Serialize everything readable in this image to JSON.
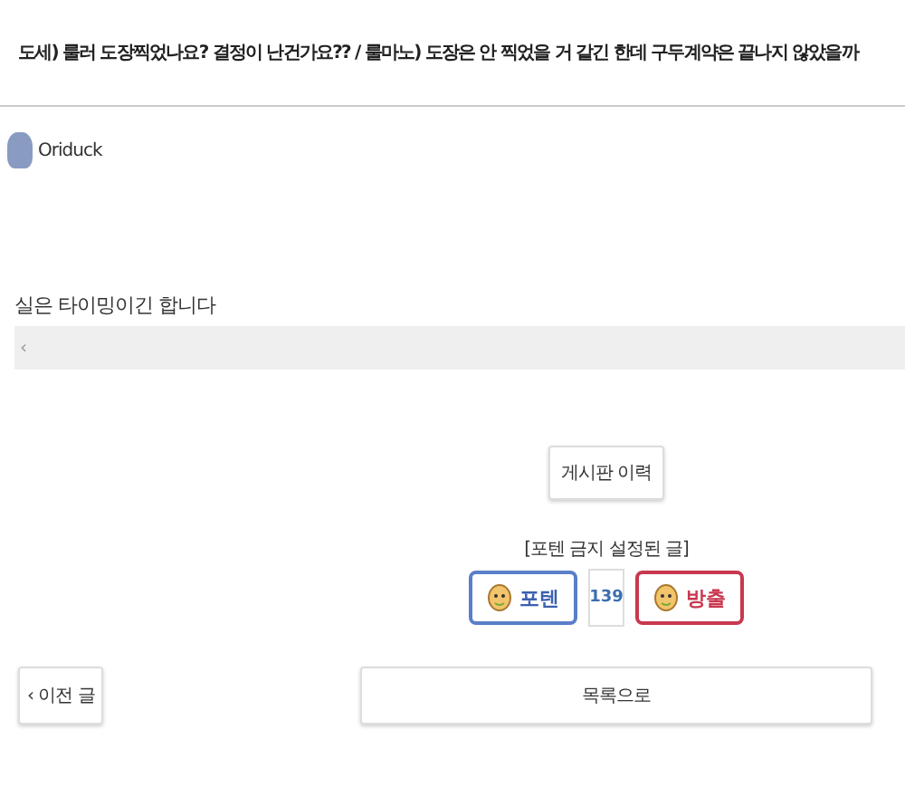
{
  "post": {
    "title": "도세) 룰러 도장찍었나요? 결정이 난건가요?? / 룰마노) 도장은 안 찍었을 거 같긴 한데 구두계약은 끝나지 않았을까",
    "author": "Oriduck",
    "body": "실은 타이밍이긴 합니다",
    "quote": "‹"
  },
  "history_button": "게시판 이력",
  "vote": {
    "notice": "[포텐 금지 설정된 글]",
    "up_label": "포텐",
    "count": "139",
    "down_label": "방출"
  },
  "nav": {
    "prev": "‹ 이전 글",
    "list": "목록으로"
  }
}
